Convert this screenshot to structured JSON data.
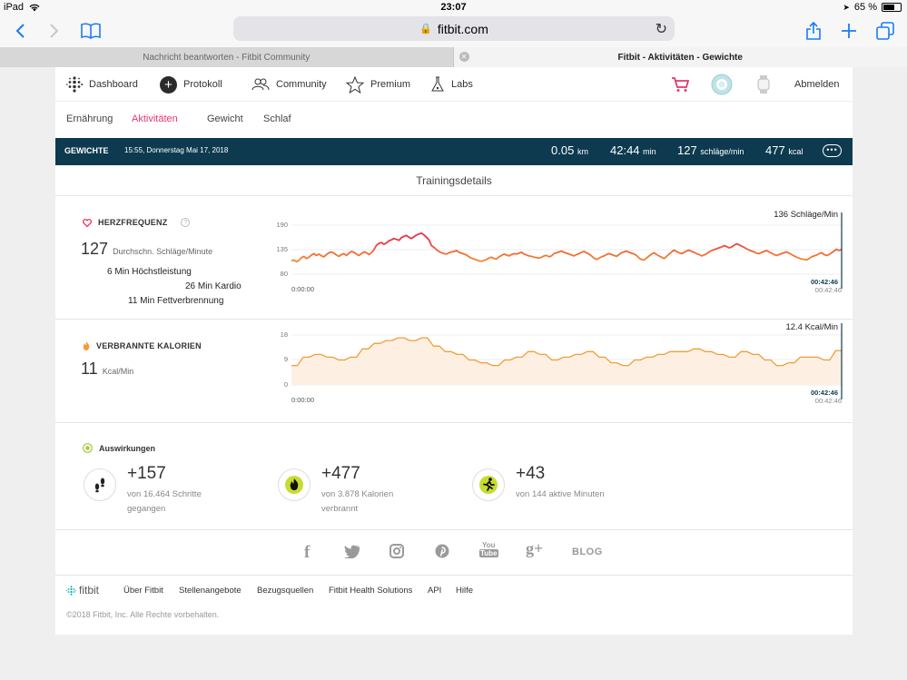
{
  "status_bar": {
    "device": "iPad",
    "time": "23:07",
    "battery": "65 %",
    "battery_level": 0.65
  },
  "browser": {
    "url": "fitbit.com"
  },
  "tabs": [
    {
      "title": "Nachricht beantworten - Fitbit Community"
    },
    {
      "title": "Fitbit - Aktivitäten - Gewichte"
    }
  ],
  "nav": {
    "dashboard": "Dashboard",
    "protokoll": "Protokoll",
    "community": "Community",
    "premium": "Premium",
    "labs": "Labs",
    "logout": "Abmelden"
  },
  "subnav": [
    "Ernährung",
    "Aktivitäten",
    "Gewicht",
    "Schlaf"
  ],
  "banner": {
    "activity": "GEWICHTE",
    "datetime": "15:55, Donnerstag Mai 17, 2018",
    "distance": "0.05",
    "distance_unit": "km",
    "duration": "42:44",
    "duration_unit": "min",
    "heart": "127",
    "heart_unit": "schläge/min",
    "calories": "477",
    "calories_unit": "kcal",
    "more": "•••"
  },
  "section_title": "Trainingsdetails",
  "heart_rate": {
    "label": "HERZFREQUENZ",
    "help": "?",
    "avg": "127",
    "avg_label": "Durchschn. Schläge/Minute",
    "zones": [
      "6 Min Höchstleistung",
      "26 Min Kardio",
      "11 Min Fettverbrennung"
    ],
    "cursor_value": "136 Schläge/Min"
  },
  "calories_section": {
    "label": "VERBRANNTE KALORIEN",
    "avg": "11",
    "avg_label": "Kcal/Min",
    "cursor_value": "12.4 Kcal/Min"
  },
  "chart_data": [
    {
      "type": "line",
      "name": "Herzfrequenz",
      "x_start": "0:00:00",
      "x_end": "00:42:46",
      "cursor_label": "00:42:46",
      "ylim": [
        80,
        190
      ],
      "yticks": [
        190,
        135,
        80
      ],
      "values": [
        110,
        112,
        108,
        111,
        117,
        120,
        115,
        118,
        123,
        126,
        122,
        125,
        121,
        119,
        124,
        128,
        130,
        127,
        123,
        120,
        124,
        126,
        122,
        127,
        131,
        129,
        125,
        122,
        126,
        130,
        128,
        124,
        128,
        135,
        145,
        149,
        151,
        147,
        150,
        155,
        157,
        160,
        158,
        156,
        162,
        165,
        167,
        163,
        160,
        164,
        168,
        170,
        172,
        168,
        163,
        157,
        144,
        140,
        135,
        131,
        128,
        126,
        125,
        128,
        130,
        131,
        133,
        129,
        127,
        125,
        123,
        119,
        116,
        114,
        112,
        110,
        109,
        111,
        113,
        116,
        118,
        115,
        114,
        119,
        122,
        125,
        123,
        121,
        124,
        126,
        125,
        127,
        129,
        125,
        123,
        121,
        120,
        118,
        117,
        116,
        118,
        121,
        122,
        119,
        121,
        126,
        128,
        130,
        132,
        129,
        127,
        125,
        123,
        121,
        124,
        126,
        129,
        131,
        128,
        125,
        121,
        116,
        113,
        116,
        119,
        121,
        124,
        126,
        124,
        122,
        120,
        124,
        128,
        130,
        132,
        129,
        127,
        125,
        122,
        116,
        113,
        112,
        116,
        121,
        125,
        128,
        124,
        121,
        118,
        115,
        120,
        125,
        130,
        134,
        131,
        128,
        126,
        129,
        132,
        134,
        131,
        129,
        126,
        124,
        121,
        123,
        126,
        130,
        133,
        135,
        137,
        139,
        141,
        144,
        142,
        139,
        141,
        145,
        148,
        146,
        143,
        140,
        137,
        134,
        132,
        130,
        127,
        126,
        129,
        131,
        133,
        130,
        127,
        124,
        122,
        124,
        126,
        128,
        130,
        127,
        124,
        121,
        118,
        116,
        114,
        113,
        112,
        115,
        119,
        121,
        123,
        126,
        128,
        124,
        122,
        124,
        128,
        132,
        136,
        133,
        136
      ]
    },
    {
      "type": "area",
      "name": "Verbrannte Kalorien",
      "x_start": "0:00:00",
      "x_end": "00:42:46",
      "cursor_label": "00:42:46",
      "ylim": [
        0,
        18
      ],
      "yticks": [
        18,
        9,
        0
      ],
      "values": [
        7,
        7,
        10,
        10,
        11,
        11,
        10,
        10,
        9,
        9,
        10,
        10,
        13,
        13,
        15,
        15,
        16,
        16,
        17,
        17,
        16,
        16,
        17,
        17,
        14,
        14,
        12,
        12,
        11,
        11,
        9,
        9,
        8,
        8,
        7,
        7,
        9,
        9,
        10,
        10,
        12,
        12,
        11,
        11,
        9,
        9,
        10,
        10,
        11,
        11,
        12,
        12,
        10,
        10,
        8,
        8,
        7,
        7,
        9,
        9,
        10,
        10,
        11,
        11,
        12,
        12,
        12,
        12,
        13,
        13,
        12,
        12,
        11,
        11,
        10,
        10,
        12,
        12,
        11,
        11,
        9,
        9,
        7,
        7,
        8,
        8,
        10,
        10,
        10,
        10,
        9,
        9,
        12.4,
        12.4
      ]
    }
  ],
  "impacts": {
    "title": "Auswirkungen",
    "items": [
      {
        "value": "+157",
        "line1": "von 16.464 Schritte",
        "line2": "gegangen"
      },
      {
        "value": "+477",
        "line1": "von 3.878 Kalorien",
        "line2": "verbrannt"
      },
      {
        "value": "+43",
        "line1": "von 144 aktive Minuten",
        "line2": ""
      }
    ]
  },
  "social": {
    "facebook": "f",
    "youtube": "You",
    "googleplus": "g+",
    "blog": "BLOG"
  },
  "footer": {
    "brand": "fitbit",
    "links": [
      "Über Fitbit",
      "Stellenangebote",
      "Bezugsquellen",
      "Fitbit Health Solutions",
      "API",
      "Hilfe"
    ],
    "copyright": "©2018 Fitbit, Inc. Alle Rechte vorbehalten."
  },
  "colors": {
    "accent": "#e5386d",
    "banner": "#0d3a4f",
    "ios_blue": "#1a7cf5",
    "hr_low": "#f5a623",
    "hr_high": "#e8214b",
    "cal": "#f29c38"
  }
}
